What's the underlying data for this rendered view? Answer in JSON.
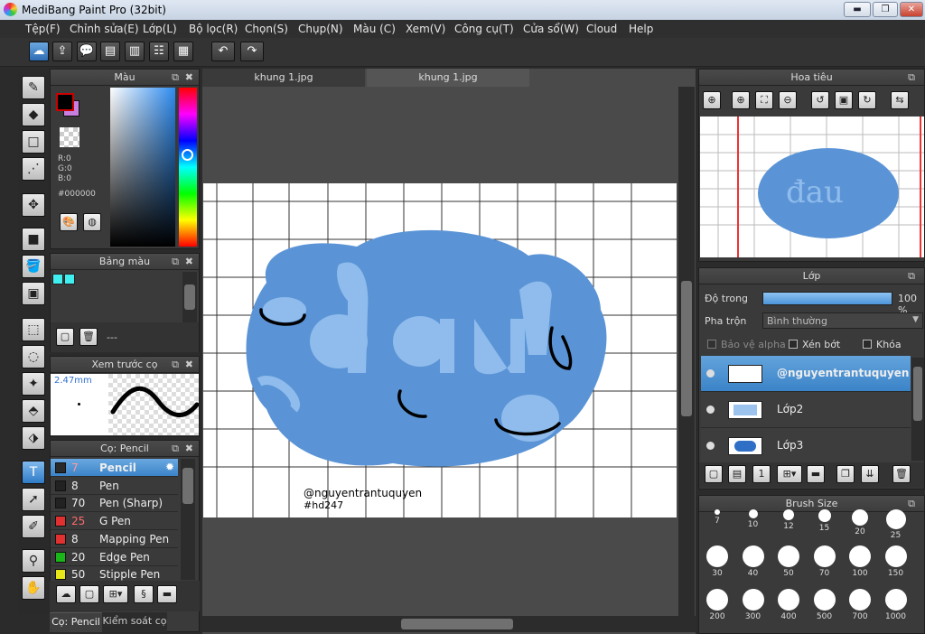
{
  "window": {
    "title": "MediBang Paint Pro (32bit)",
    "min": "▬",
    "max": "❐",
    "close": "✕"
  },
  "menu": [
    "Tệp(F)",
    "Chỉnh sửa(E)",
    "Lớp(L)",
    "Bộ lọc(R)",
    "Chọn(S)",
    "Chụp(N)",
    "Màu (C)",
    "Xem(V)",
    "Công cụ(T)",
    "Cửa sổ(W)",
    "Cloud",
    "Help"
  ],
  "color_panel": {
    "title": "Màu",
    "r": "R:0",
    "g": "G:0",
    "b": "B:0",
    "hex": "#000000"
  },
  "palette_panel": {
    "title": "Bảng màu",
    "value": "---"
  },
  "preview_panel": {
    "title": "Xem trước cọ",
    "size": "2.47mm"
  },
  "brush_panel": {
    "title": "Cọ: Pencil",
    "items": [
      {
        "size": "7",
        "name": "Pencil",
        "color": "#2a2a2a"
      },
      {
        "size": "8",
        "name": "Pen",
        "color": "#222222"
      },
      {
        "size": "70",
        "name": "Pen (Sharp)",
        "color": "#222222"
      },
      {
        "size": "25",
        "name": "G Pen",
        "color": "#e03030"
      },
      {
        "size": "8",
        "name": "Mapping Pen",
        "color": "#e03030"
      },
      {
        "size": "20",
        "name": "Edge Pen",
        "color": "#19b519"
      },
      {
        "size": "50",
        "name": "Stipple Pen",
        "color": "#e6e619"
      }
    ],
    "tabs": [
      "Cọ: Pencil",
      "Kiểm soát cọ"
    ]
  },
  "doc_tabs": [
    "khung 1.jpg",
    "khung 1.jpg"
  ],
  "canvas": {
    "caption1": "@nguyentrantuquyen",
    "caption2": "#hd247"
  },
  "navigator": {
    "title": "Hoa tiêu"
  },
  "layer_panel": {
    "title": "Lớp",
    "opacity_label": "Độ trong",
    "opacity_value": "100 %",
    "opacity": 1.0,
    "blend_label": "Pha trộn",
    "blend_value": "Bình thường",
    "protect_alpha": "Bảo vệ alpha",
    "clip": "Xén bớt",
    "lock": "Khóa",
    "layers": [
      "@nguyentrantuquyen",
      "Lớp2",
      "Lớp3"
    ]
  },
  "brush_size": {
    "title": "Brush Size",
    "sizes": [
      "7",
      "10",
      "12",
      "15",
      "20",
      "25",
      "30",
      "40",
      "50",
      "70",
      "100",
      "150",
      "200",
      "300",
      "400",
      "500",
      "700",
      "1000"
    ]
  }
}
